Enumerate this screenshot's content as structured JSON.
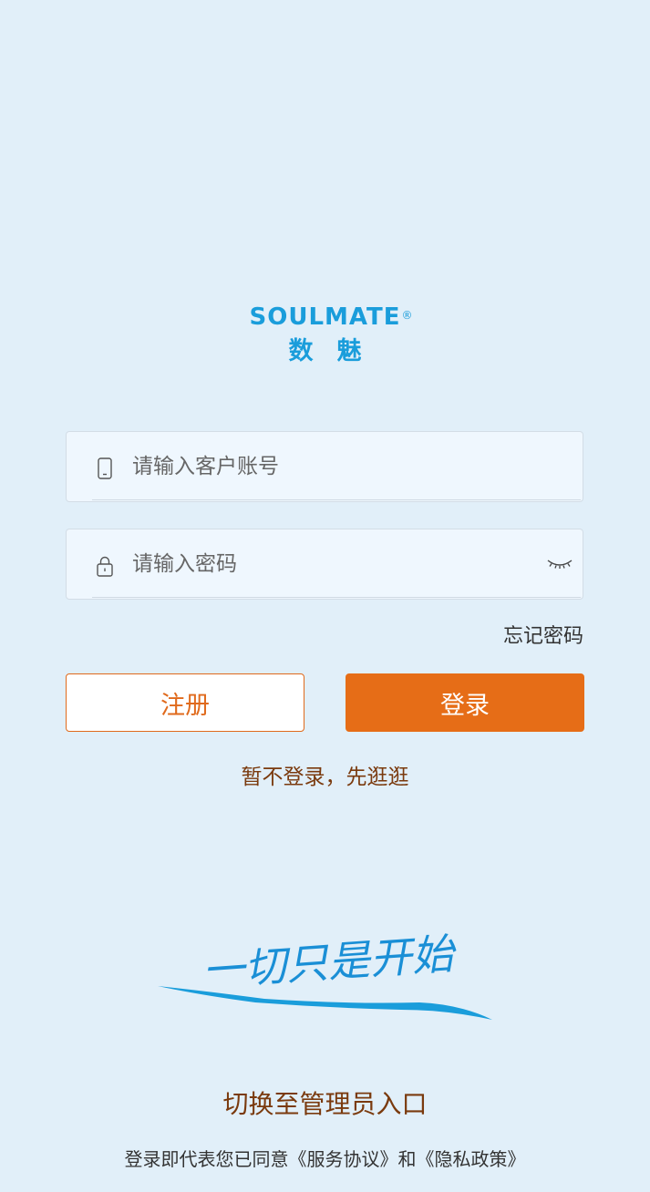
{
  "logo": {
    "brand_en": "SOULMATE",
    "registered_mark": "®",
    "brand_cn": "数魅"
  },
  "account_field": {
    "placeholder": "请输入客户账号",
    "value": "",
    "icon": "phone-icon"
  },
  "password_field": {
    "placeholder": "请输入密码",
    "value": "",
    "icon": "lock-icon",
    "toggle_icon": "eye-closed-icon"
  },
  "forgot_password": "忘记密码",
  "buttons": {
    "register": "注册",
    "login": "登录"
  },
  "browse_without_login": "暂不登录，先逛逛",
  "slogan": "一切只是开始",
  "switch_admin": "切换至管理员入口",
  "agreement": {
    "prefix": "登录即代表您已同意",
    "service": "《服务协议》",
    "and": "和",
    "privacy": "《隐私政策》"
  },
  "colors": {
    "background": "#e1eff9",
    "brand_blue": "#1a9ddb",
    "accent_orange": "#e66d17",
    "link_brown": "#7a3a0e"
  }
}
